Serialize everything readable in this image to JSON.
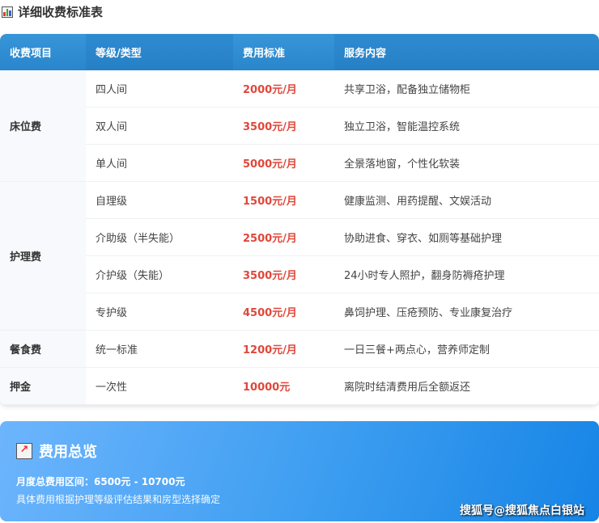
{
  "title": "详细收费标准表",
  "headers": [
    "收费项目",
    "等级/类型",
    "费用标准",
    "服务内容"
  ],
  "categories": [
    "床位费",
    "护理费",
    "餐食费",
    "押金"
  ],
  "rows": [
    {
      "grade": "四人间",
      "price": "2000元/月",
      "desc": "共享卫浴，配备独立储物柜"
    },
    {
      "grade": "双人间",
      "price": "3500元/月",
      "desc": "独立卫浴，智能温控系统"
    },
    {
      "grade": "单人间",
      "price": "5000元/月",
      "desc": "全景落地窗，个性化软装"
    },
    {
      "grade": "自理级",
      "price": "1500元/月",
      "desc": "健康监测、用药提醒、文娱活动"
    },
    {
      "grade": "介助级（半失能）",
      "price": "2500元/月",
      "desc": "协助进食、穿衣、如厕等基础护理"
    },
    {
      "grade": "介护级（失能）",
      "price": "3500元/月",
      "desc": "24小时专人照护，翻身防褥疮护理"
    },
    {
      "grade": "专护级",
      "price": "4500元/月",
      "desc": "鼻饲护理、压疮预防、专业康复治疗"
    },
    {
      "grade": "统一标准",
      "price": "1200元/月",
      "desc": "一日三餐+两点心，营养师定制"
    },
    {
      "grade": "一次性",
      "price": "10000元",
      "desc": "离院时结清费用后全额返还"
    }
  ],
  "summary": {
    "title": "费用总览",
    "range": "月度总费用区间：6500元 - 10700元",
    "note": "具体费用根据护理等级评估结果和房型选择确定"
  },
  "watermark": "搜狐号@搜狐焦点白银站"
}
